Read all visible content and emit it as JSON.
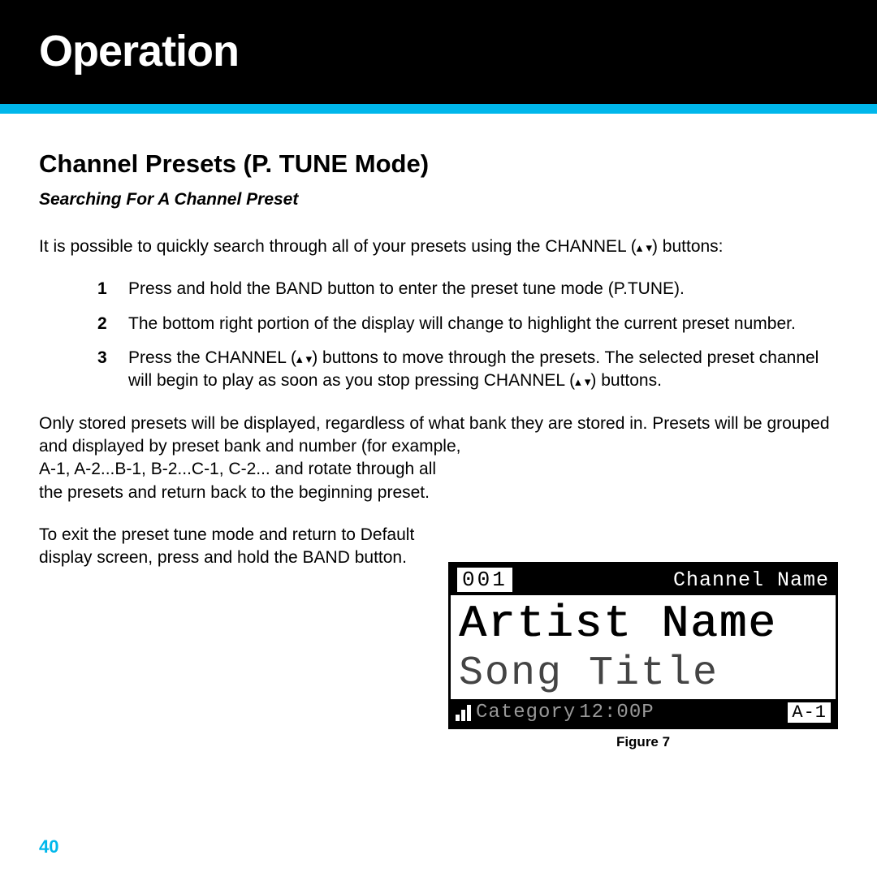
{
  "header": {
    "title": "Operation"
  },
  "section": {
    "title": "Channel Presets (P. TUNE Mode)",
    "subtitle": "Searching For A Channel Preset",
    "intro_pre": "It is possible to quickly search through all of your presets using the CHANNEL (",
    "intro_post": ") buttons:",
    "steps": [
      {
        "n": "1",
        "text": "Press and hold the BAND button to enter the preset tune mode (P.TUNE)."
      },
      {
        "n": "2",
        "text": "The bottom right portion of the display will change to highlight the current preset number."
      },
      {
        "n": "3",
        "pre": "Press the CHANNEL (",
        "mid": ") buttons to move through the presets. The selected preset channel will begin to play as soon as you stop pressing CHANNEL (",
        "post": ") buttons."
      }
    ],
    "para2a": "Only stored presets will be displayed, regardless of what bank they are stored in. Presets will be grouped and displayed by preset bank and number (for example,",
    "para2b": "A-1, A-2...B-1, B-2...C-1, C-2... and rotate through all the presets and return back to the beginning preset.",
    "para3": "To exit the preset tune mode and return to Default display screen, press and hold the BAND button."
  },
  "lcd": {
    "channel_number": "001",
    "channel_name": "Channel Name",
    "artist": "Artist Name",
    "song": "Song Title",
    "category": "Category",
    "time": "12:00P",
    "preset": "A-1"
  },
  "figure_caption": "Figure 7",
  "page_number": "40",
  "icons": {
    "up": "▴",
    "down": "▾"
  }
}
